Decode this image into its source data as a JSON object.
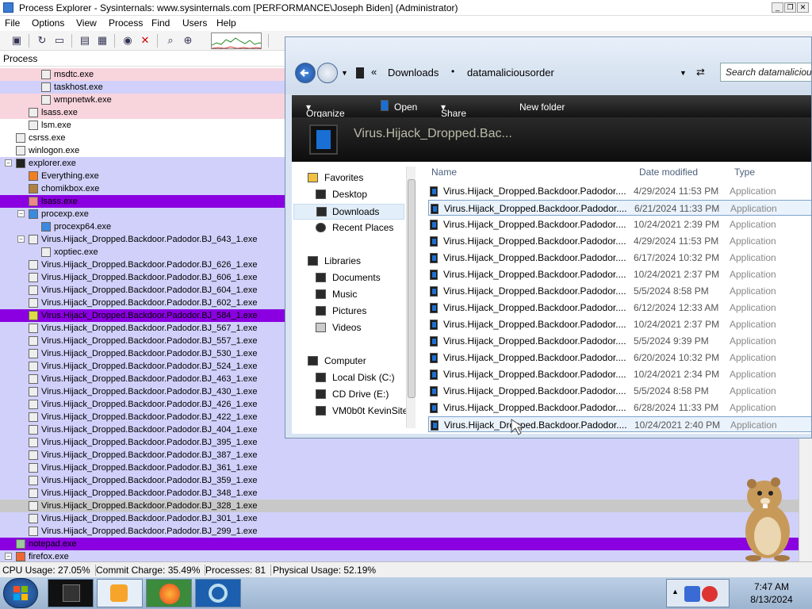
{
  "window": {
    "title": "Process Explorer - Sysinternals: www.sysinternals.com [PERFORMANCE\\Joseph Biden] (Administrator)"
  },
  "menu": [
    "File",
    "Options",
    "View",
    "Process",
    "Find",
    "Users",
    "Help"
  ],
  "column_header": "Process",
  "processes": [
    {
      "name": "msdtc.exe",
      "bg": "pink"
    },
    {
      "name": "taskhost.exe",
      "bg": "lav"
    },
    {
      "name": "wmpnetwk.exe",
      "bg": "pink"
    },
    {
      "name": "lsass.exe",
      "bg": "pink"
    },
    {
      "name": "lsm.exe",
      "bg": "white"
    },
    {
      "name": "csrss.exe",
      "bg": "white"
    },
    {
      "name": "winlogon.exe",
      "bg": "white"
    },
    {
      "name": "explorer.exe",
      "bg": "lav"
    },
    {
      "name": "Everything.exe",
      "bg": "lav"
    },
    {
      "name": "chomikbox.exe",
      "bg": "lav"
    },
    {
      "name": "lsass.exe",
      "bg": "purple"
    },
    {
      "name": "procexp.exe",
      "bg": "lav"
    },
    {
      "name": "procexp64.exe",
      "bg": "lav"
    },
    {
      "name": "Virus.Hijack_Dropped.Backdoor.Padodor.BJ_643_1.exe",
      "bg": "lav"
    },
    {
      "name": "xoptiec.exe",
      "bg": "lav"
    },
    {
      "name": "Virus.Hijack_Dropped.Backdoor.Padodor.BJ_626_1.exe",
      "bg": "lav"
    },
    {
      "name": "Virus.Hijack_Dropped.Backdoor.Padodor.BJ_606_1.exe",
      "bg": "lav"
    },
    {
      "name": "Virus.Hijack_Dropped.Backdoor.Padodor.BJ_604_1.exe",
      "bg": "lav"
    },
    {
      "name": "Virus.Hijack_Dropped.Backdoor.Padodor.BJ_602_1.exe",
      "bg": "lav"
    },
    {
      "name": "Virus.Hijack_Dropped.Backdoor.Padodor.BJ_584_1.exe",
      "bg": "purple"
    },
    {
      "name": "Virus.Hijack_Dropped.Backdoor.Padodor.BJ_567_1.exe",
      "bg": "lav"
    },
    {
      "name": "Virus.Hijack_Dropped.Backdoor.Padodor.BJ_557_1.exe",
      "bg": "lav"
    },
    {
      "name": "Virus.Hijack_Dropped.Backdoor.Padodor.BJ_530_1.exe",
      "bg": "lav"
    },
    {
      "name": "Virus.Hijack_Dropped.Backdoor.Padodor.BJ_524_1.exe",
      "bg": "lav"
    },
    {
      "name": "Virus.Hijack_Dropped.Backdoor.Padodor.BJ_463_1.exe",
      "bg": "lav"
    },
    {
      "name": "Virus.Hijack_Dropped.Backdoor.Padodor.BJ_430_1.exe",
      "bg": "lav"
    },
    {
      "name": "Virus.Hijack_Dropped.Backdoor.Padodor.BJ_426_1.exe",
      "bg": "lav"
    },
    {
      "name": "Virus.Hijack_Dropped.Backdoor.Padodor.BJ_422_1.exe",
      "bg": "lav"
    },
    {
      "name": "Virus.Hijack_Dropped.Backdoor.Padodor.BJ_404_1.exe",
      "bg": "lav"
    },
    {
      "name": "Virus.Hijack_Dropped.Backdoor.Padodor.BJ_395_1.exe",
      "bg": "lav"
    },
    {
      "name": "Virus.Hijack_Dropped.Backdoor.Padodor.BJ_387_1.exe",
      "bg": "lav"
    },
    {
      "name": "Virus.Hijack_Dropped.Backdoor.Padodor.BJ_361_1.exe",
      "bg": "lav"
    },
    {
      "name": "Virus.Hijack_Dropped.Backdoor.Padodor.BJ_359_1.exe",
      "bg": "lav"
    },
    {
      "name": "Virus.Hijack_Dropped.Backdoor.Padodor.BJ_348_1.exe",
      "bg": "lav"
    },
    {
      "name": "Virus.Hijack_Dropped.Backdoor.Padodor.BJ_328_1.exe",
      "bg": "gray"
    },
    {
      "name": "Virus.Hijack_Dropped.Backdoor.Padodor.BJ_301_1.exe",
      "bg": "lav"
    },
    {
      "name": "Virus.Hijack_Dropped.Backdoor.Padodor.BJ_299_1.exe",
      "bg": "lav"
    },
    {
      "name": "notepad.exe",
      "bg": "purple"
    },
    {
      "name": "firefox.exe",
      "bg": "lav"
    }
  ],
  "status": {
    "cpu": "CPU Usage: 27.05%",
    "commit": "Commit Charge: 35.49%",
    "processes": "Processes: 81",
    "physical": "Physical Usage: 52.19%"
  },
  "explorer": {
    "breadcrumb": [
      "Downloads",
      "datamaliciousorder"
    ],
    "search_placeholder": "Search datamalicious...",
    "commands": [
      "Organize",
      "Open",
      "Share with",
      "New folder"
    ],
    "preview_text": "Virus.Hijack_Dropped.Bac...",
    "nav": {
      "favorites": "Favorites",
      "desktop": "Desktop",
      "downloads": "Downloads",
      "recent": "Recent Places",
      "libraries": "Libraries",
      "documents": "Documents",
      "music": "Music",
      "pictures": "Pictures",
      "videos": "Videos",
      "computer": "Computer",
      "localdisk": "Local Disk (C:)",
      "cddrive": "CD Drive (E:)",
      "vm": "VM0b0t KevinSite"
    },
    "columns": {
      "name": "Name",
      "date": "Date modified",
      "type": "Type"
    },
    "files": [
      {
        "name": "Virus.Hijack_Dropped.Backdoor.Padodor....",
        "date": "4/29/2024 11:53 PM",
        "type": "Application"
      },
      {
        "name": "Virus.Hijack_Dropped.Backdoor.Padodor....",
        "date": "6/21/2024 11:33 PM",
        "type": "Application"
      },
      {
        "name": "Virus.Hijack_Dropped.Backdoor.Padodor....",
        "date": "10/24/2021 2:39 PM",
        "type": "Application"
      },
      {
        "name": "Virus.Hijack_Dropped.Backdoor.Padodor....",
        "date": "4/29/2024 11:53 PM",
        "type": "Application"
      },
      {
        "name": "Virus.Hijack_Dropped.Backdoor.Padodor....",
        "date": "6/17/2024 10:32 PM",
        "type": "Application"
      },
      {
        "name": "Virus.Hijack_Dropped.Backdoor.Padodor....",
        "date": "10/24/2021 2:37 PM",
        "type": "Application"
      },
      {
        "name": "Virus.Hijack_Dropped.Backdoor.Padodor....",
        "date": "5/5/2024 8:58 PM",
        "type": "Application"
      },
      {
        "name": "Virus.Hijack_Dropped.Backdoor.Padodor....",
        "date": "6/12/2024 12:33 AM",
        "type": "Application"
      },
      {
        "name": "Virus.Hijack_Dropped.Backdoor.Padodor....",
        "date": "10/24/2021 2:37 PM",
        "type": "Application"
      },
      {
        "name": "Virus.Hijack_Dropped.Backdoor.Padodor....",
        "date": "5/5/2024 9:39 PM",
        "type": "Application"
      },
      {
        "name": "Virus.Hijack_Dropped.Backdoor.Padodor....",
        "date": "6/20/2024 10:32 PM",
        "type": "Application"
      },
      {
        "name": "Virus.Hijack_Dropped.Backdoor.Padodor....",
        "date": "10/24/2021 2:34 PM",
        "type": "Application"
      },
      {
        "name": "Virus.Hijack_Dropped.Backdoor.Padodor....",
        "date": "5/5/2024 8:58 PM",
        "type": "Application"
      },
      {
        "name": "Virus.Hijack_Dropped.Backdoor.Padodor....",
        "date": "6/28/2024 11:33 PM",
        "type": "Application"
      },
      {
        "name": "Virus.Hijack_Dropped.Backdoor.Padodor....",
        "date": "10/24/2021 2:40 PM",
        "type": "Application"
      }
    ]
  },
  "taskbar": {
    "time": "7:47 AM",
    "date": "8/13/2024"
  },
  "colors": {
    "pink": "#f8d4dc",
    "lavender": "#d0d0fa",
    "purple": "#8a00e0",
    "gray": "#c8c8c8"
  }
}
